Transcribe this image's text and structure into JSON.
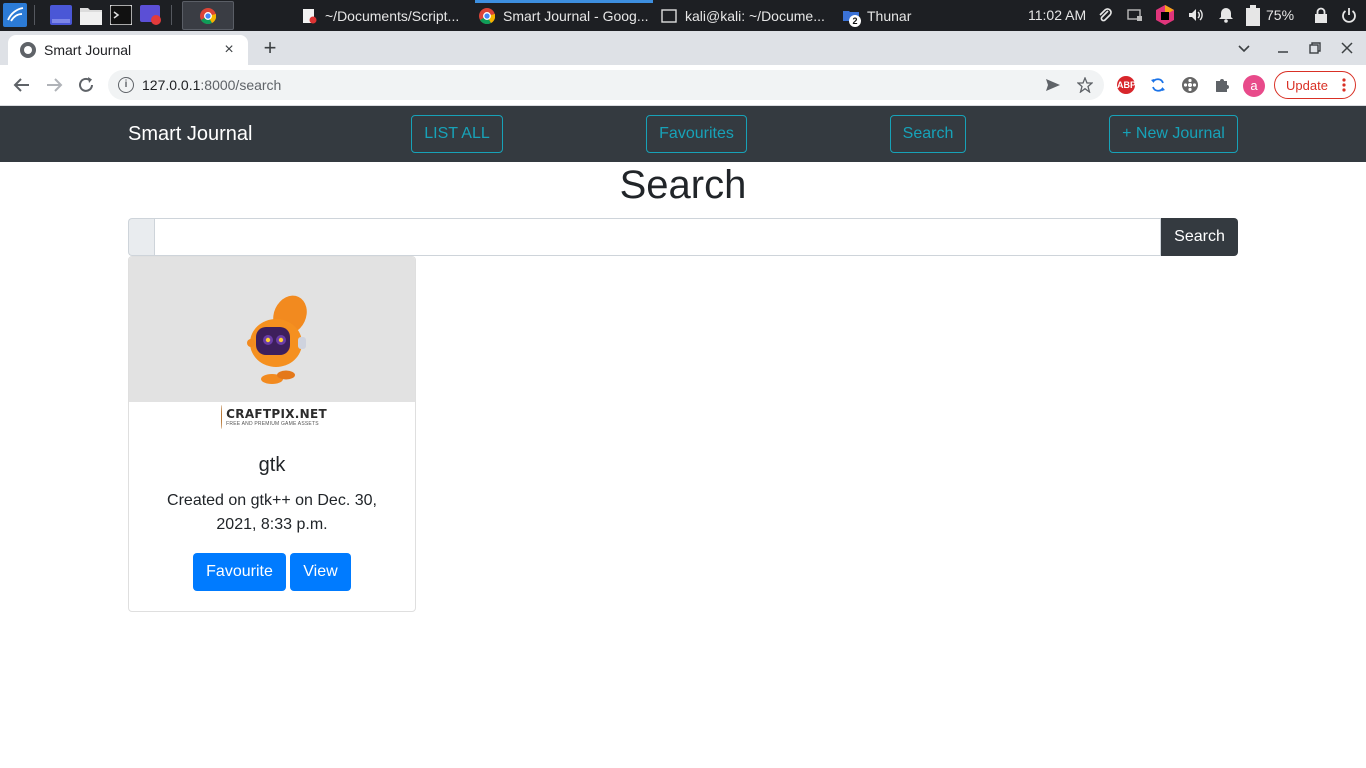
{
  "taskbar": {
    "tasks": [
      {
        "label": "~/Documents/Script...",
        "icon": "text-editor-icon"
      },
      {
        "label": "Smart Journal - Goog...",
        "icon": "chrome-icon"
      },
      {
        "label": "kali@kali: ~/Docume...",
        "icon": "terminal-icon"
      },
      {
        "label": "Thunar",
        "icon": "file-manager-icon",
        "badge": "2"
      }
    ],
    "clock": "11:02 AM",
    "battery": "75%"
  },
  "browser": {
    "tab_title": "Smart Journal",
    "tab_close": "×",
    "new_tab": "+",
    "url_host": "127.0.0.1",
    "url_path": ":8000/search",
    "update_label": "Update",
    "profile_initial": "a",
    "ext_abp": "ABP"
  },
  "navbar": {
    "brand": "Smart Journal",
    "links": [
      "LIST ALL",
      "Favourites",
      "Search",
      "+ New Journal"
    ]
  },
  "page": {
    "title": "Search",
    "search_value": "",
    "search_button": "Search"
  },
  "card": {
    "image_caption": "CRAFTPIX.NET",
    "image_subcaption": "FREE AND PREMIUM GAME ASSETS",
    "title": "gtk",
    "text": "Created on gtk++ on Dec. 30, 2021, 8:33 p.m.",
    "favourite_button": "Favourite",
    "view_button": "View"
  },
  "colors": {
    "navbar_bg": "#343a40",
    "outline_accent": "#17a2b8",
    "primary": "#007bff",
    "update_red": "#d93025"
  }
}
